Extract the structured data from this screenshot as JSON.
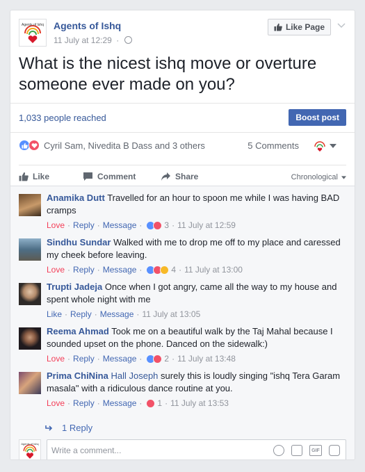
{
  "page": {
    "name": "Agents of Ishq",
    "logo_text": "Agents of Ishq",
    "timestamp": "11 July at 12:29",
    "like_page_label": "Like Page"
  },
  "post": {
    "text": "What is the nicest ishq move or overture someone ever made on you?"
  },
  "reach": {
    "text": "1,033 people reached",
    "boost_label": "Boost post"
  },
  "reactions": {
    "names": "Cyril Sam, Nivedita B Dass and 3 others",
    "comments_count": "5 Comments"
  },
  "actions": {
    "like": "Like",
    "comment": "Comment",
    "share": "Share",
    "order": "Chronological"
  },
  "comments": [
    {
      "author": "Anamika Dutt",
      "text": "Travelled for an hour to spoon me while I was having BAD cramps",
      "reaction_label": "Love",
      "reply": "Reply",
      "message": "Message",
      "count": "3",
      "time": "11 July at 12:59"
    },
    {
      "author": "Sindhu Sundar",
      "text": "Walked with me to drop me off to my place and caressed my cheek before leaving.",
      "reaction_label": "Love",
      "reply": "Reply",
      "message": "Message",
      "count": "4",
      "time": "11 July at 13:00"
    },
    {
      "author": "Trupti Jadeja",
      "text": "Once when I got angry, came all the way to my house and spent whole night with me",
      "reaction_label": "Like",
      "reply": "Reply",
      "message": "Message",
      "time": "11 July at 13:05"
    },
    {
      "author": "Reema Ahmad",
      "text": "Took me on a beautiful walk by the Taj Mahal because I sounded upset on the phone. Danced on the sidewalk:)",
      "reaction_label": "Love",
      "reply": "Reply",
      "message": "Message",
      "count": "2",
      "time": "11 July at 13:48"
    },
    {
      "author": "Prima ChiNina",
      "tag": "Hall Joseph",
      "text": "surely this is loudly singing \"ishq Tera Garam masala\" with a ridiculous dance routine at you.",
      "reaction_label": "Love",
      "reply": "Reply",
      "message": "Message",
      "count": "1",
      "time": "11 July at 13:53"
    }
  ],
  "replies": {
    "label": "1 Reply"
  },
  "write": {
    "placeholder": "Write a comment..."
  },
  "colors": {
    "link": "#365899",
    "boost": "#4267b2",
    "love": "#f33e58",
    "like_reaction": "#5890ff"
  }
}
